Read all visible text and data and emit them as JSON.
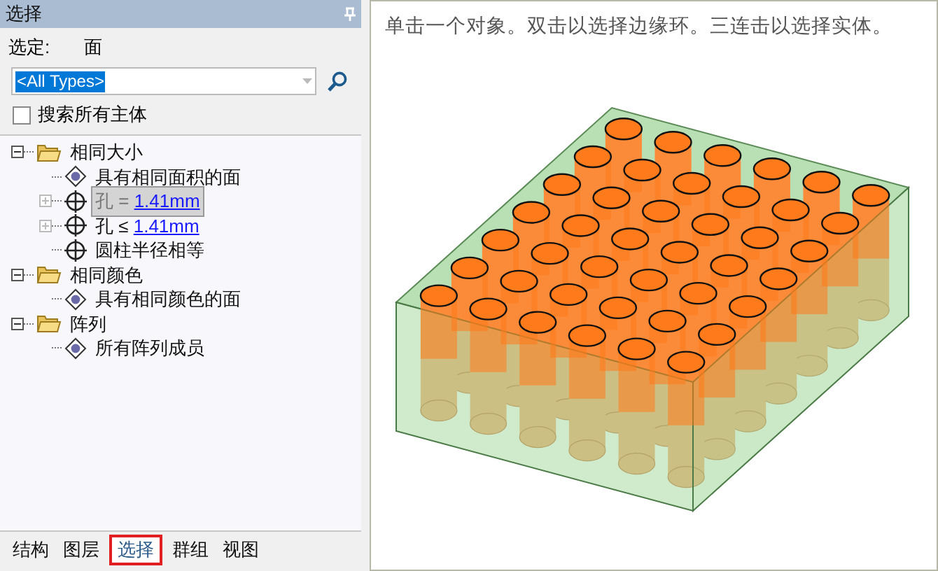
{
  "panel": {
    "title": "选择"
  },
  "selection": {
    "label": "选定:",
    "value": "面"
  },
  "type_filter": {
    "value": "<All Types>"
  },
  "search_all_bodies": {
    "label": "搜索所有主体",
    "checked": false
  },
  "tree": [
    {
      "kind": "folder",
      "label": "相同大小",
      "expanded": true,
      "selected": false,
      "children": [
        {
          "kind": "face",
          "label": "具有相同面积的面",
          "selected": false
        },
        {
          "kind": "hole",
          "label": "孔",
          "operator": "=",
          "value": "1.41mm",
          "expanded": false,
          "selected": true
        },
        {
          "kind": "hole",
          "label": "孔",
          "operator": "≤",
          "value": "1.41mm",
          "expanded": false,
          "selected": false
        },
        {
          "kind": "hole",
          "label": "圆柱半径相等",
          "selected": false
        }
      ]
    },
    {
      "kind": "folder",
      "label": "相同颜色",
      "expanded": true,
      "selected": false,
      "children": [
        {
          "kind": "face",
          "label": "具有相同颜色的面",
          "selected": false
        }
      ]
    },
    {
      "kind": "folder",
      "label": "阵列",
      "expanded": true,
      "selected": false,
      "children": [
        {
          "kind": "face",
          "label": "所有阵列成员",
          "selected": false
        }
      ]
    }
  ],
  "tabs": [
    {
      "label": "结构",
      "selected": false
    },
    {
      "label": "图层",
      "selected": false
    },
    {
      "label": "选择",
      "selected": true
    },
    {
      "label": "群组",
      "selected": false
    },
    {
      "label": "视图",
      "selected": false
    }
  ],
  "viewport": {
    "hint": "单击一个对象。双击以选择边缘环。三连击以选择实体。"
  }
}
